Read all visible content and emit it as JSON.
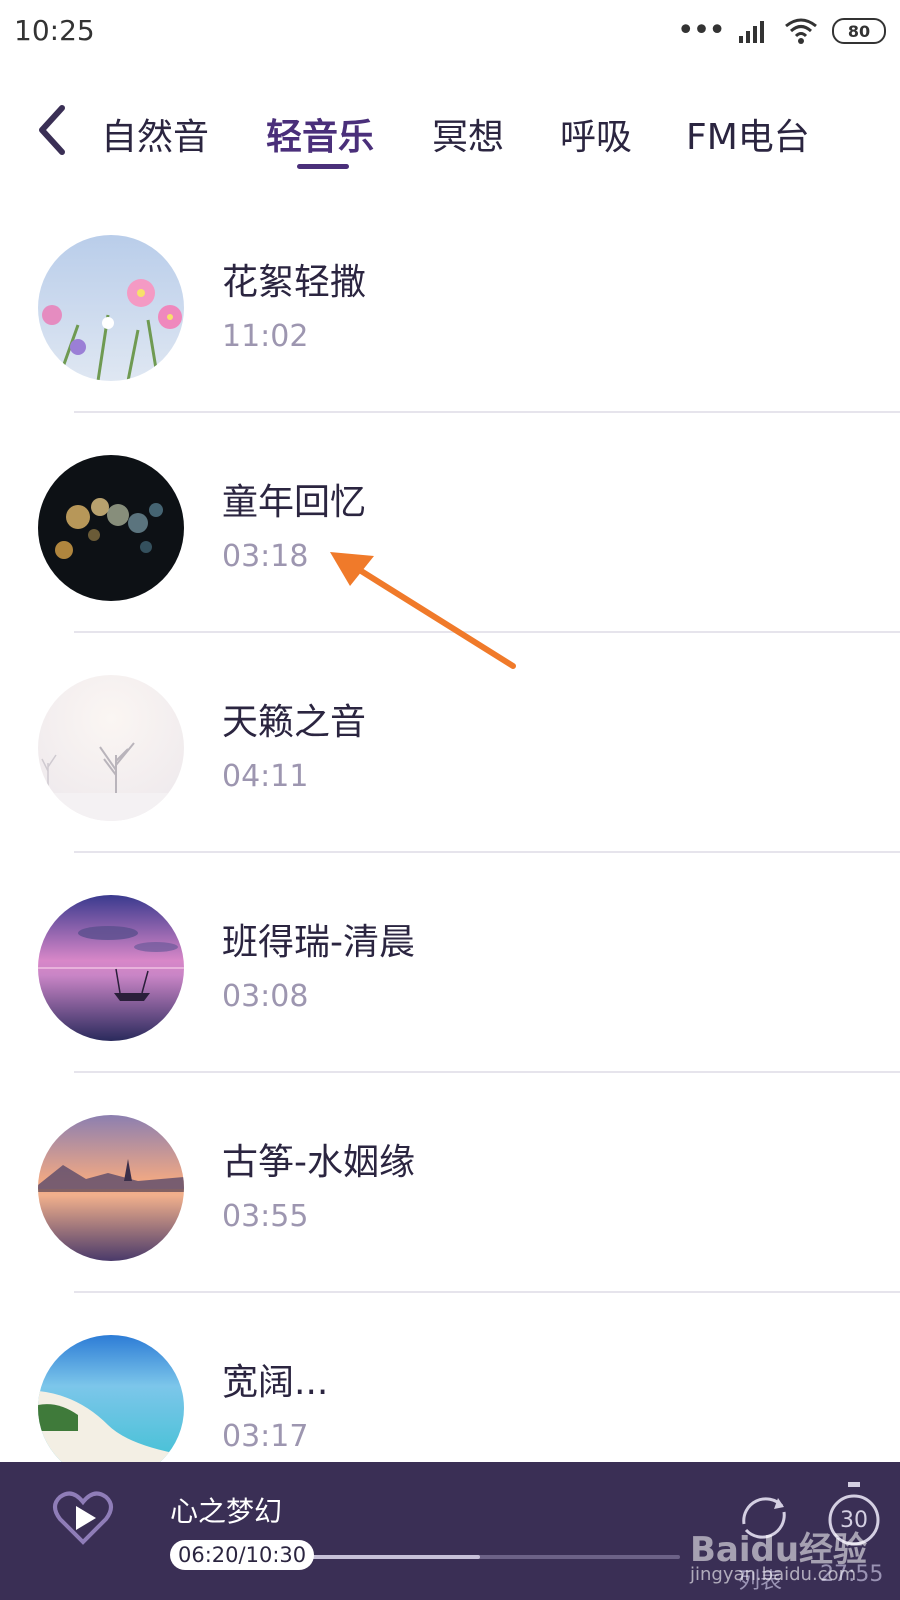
{
  "status_bar": {
    "time": "10:25",
    "battery": "80"
  },
  "tabs": [
    {
      "label": "自然音",
      "active": false
    },
    {
      "label": "轻音乐",
      "active": true
    },
    {
      "label": "冥想",
      "active": false
    },
    {
      "label": "呼吸",
      "active": false
    },
    {
      "label": "FM电台",
      "active": false
    }
  ],
  "tracks": [
    {
      "title": "花絮轻撒",
      "duration": "11:02"
    },
    {
      "title": "童年回忆",
      "duration": "03:18"
    },
    {
      "title": "天籁之音",
      "duration": "04:11"
    },
    {
      "title": "班得瑞-清晨",
      "duration": "03:08"
    },
    {
      "title": "古筝-水姻缘",
      "duration": "03:55"
    },
    {
      "title": "宽阔...",
      "duration": "03:17"
    }
  ],
  "player": {
    "title": "心之梦幻",
    "position": "06:20/10:30",
    "progress": 0.6,
    "timer": "30",
    "list_label": "列表",
    "total": "27:55"
  },
  "watermark": {
    "brand": "Baidu经验",
    "url": "jingyan.baidu.com"
  },
  "colors": {
    "accent": "#4a2f7a",
    "player_bg": "#3a2f55",
    "annotation": "#f07a2a"
  }
}
